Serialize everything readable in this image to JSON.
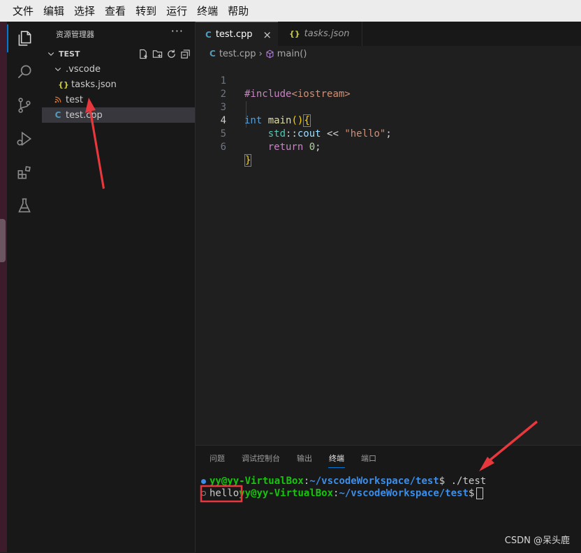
{
  "menu": [
    "文件",
    "编辑",
    "选择",
    "查看",
    "转到",
    "运行",
    "终端",
    "帮助"
  ],
  "sidebar": {
    "title": "资源管理器",
    "more": "···",
    "folder": "TEST",
    "items": [
      {
        "label": ".vscode",
        "icon": "chevron-down-icon"
      },
      {
        "label": "tasks.json",
        "icon": "json-icon"
      },
      {
        "label": "test",
        "icon": "rss-icon"
      },
      {
        "label": "test.cpp",
        "icon": "cpp-file-icon"
      }
    ]
  },
  "tabs": [
    {
      "label": "test.cpp",
      "active": true
    },
    {
      "label": "tasks.json",
      "active": false
    }
  ],
  "breadcrumb": {
    "file": "test.cpp",
    "symbol": "main()"
  },
  "editor": {
    "line_numbers": [
      "1",
      "2",
      "3",
      "4",
      "5",
      "6"
    ],
    "current_line": "4"
  },
  "panel": {
    "tabs": [
      "问题",
      "调试控制台",
      "输出",
      "终端",
      "端口"
    ],
    "active_tab": "终端",
    "line1": {
      "user": "yy@yy-VirtualBox",
      "sep": ":",
      "path": "~/vscodeWorkspace/test",
      "prompt": "$",
      "command": " ./test"
    },
    "line2": {
      "output": "hello",
      "user": "yy@yy-VirtualBox",
      "sep": ":",
      "path": "~/vscodeWorkspace/test",
      "prompt": "$"
    }
  },
  "watermark": "CSDN @呆头鹿",
  "colors": {
    "accent": "#0078d4",
    "annotation_red": "#e8383d"
  }
}
